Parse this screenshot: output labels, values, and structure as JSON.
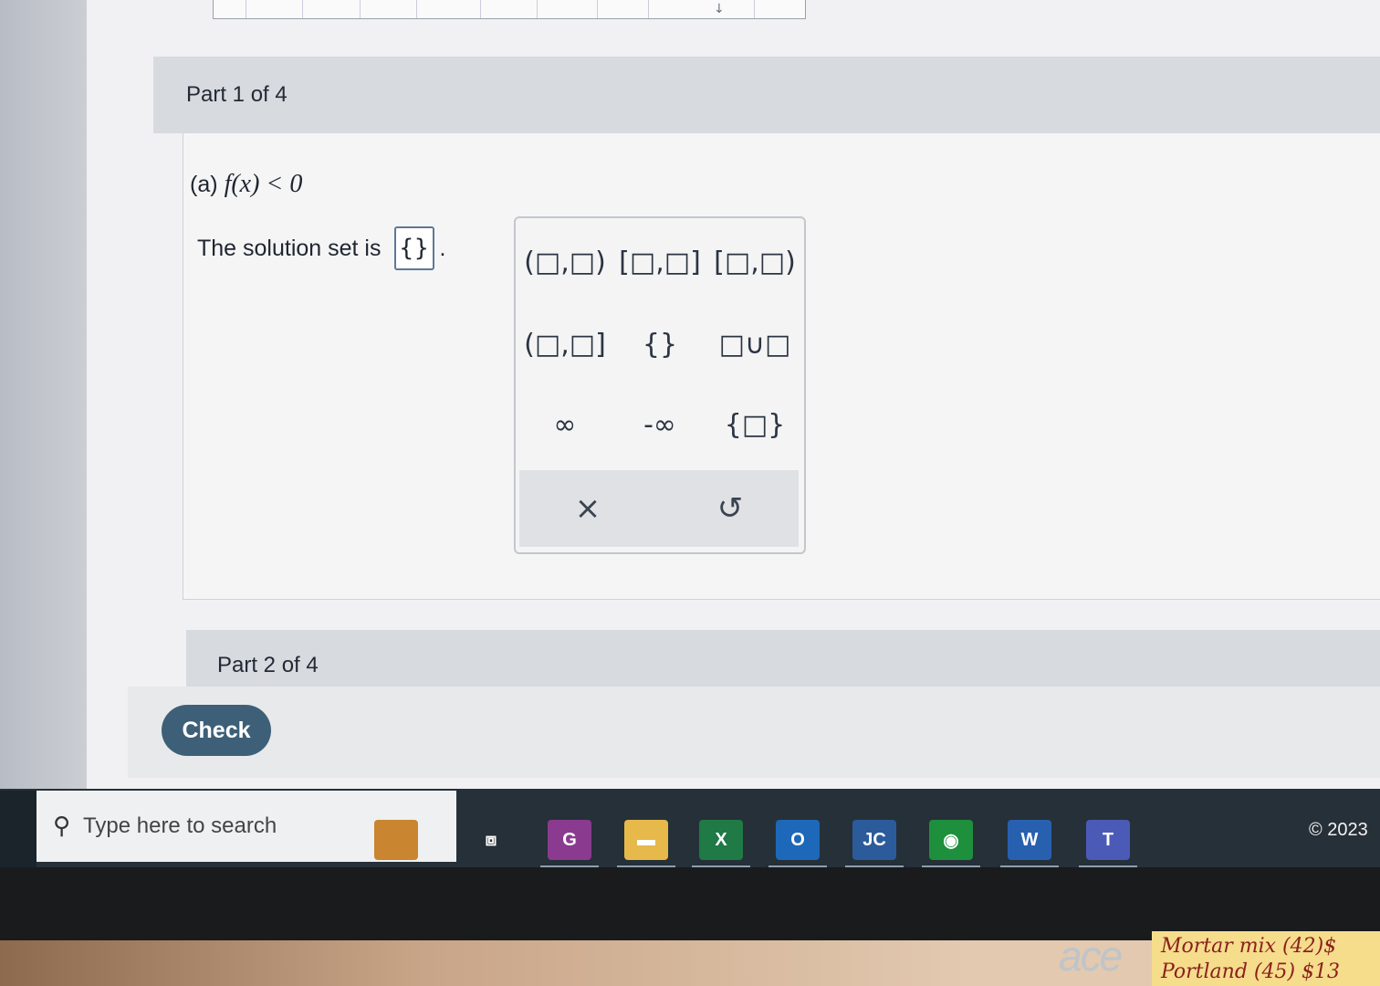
{
  "part1": {
    "header": "Part 1 of 4"
  },
  "question": {
    "prefix": "(a)",
    "expression": "f(x) < 0"
  },
  "solution": {
    "label": "The solution set is",
    "value": "{}",
    "suffix": "."
  },
  "palette": {
    "buttons": [
      "(□,□)",
      "[□,□]",
      "[□,□)",
      "(□,□]",
      "{}",
      "□∪□",
      "∞",
      "-∞",
      "{□}"
    ],
    "clear": "×",
    "undo": "↺"
  },
  "part2": {
    "header": "Part 2 of 4"
  },
  "check_button": "Check",
  "taskbar": {
    "search_placeholder": "Type here to search",
    "search_icon": "⚲",
    "apps": [
      {
        "name": "briefcase",
        "label": "",
        "color": "#c9852f"
      },
      {
        "name": "task-view",
        "label": "⧈",
        "color": "#263038"
      },
      {
        "name": "pdf",
        "label": "G",
        "color": "#8a3b8f"
      },
      {
        "name": "file-explorer",
        "label": "▬",
        "color": "#e6b94a"
      },
      {
        "name": "excel",
        "label": "X",
        "color": "#1f7a45"
      },
      {
        "name": "outlook",
        "label": "O",
        "color": "#1d68b8"
      },
      {
        "name": "jc",
        "label": "JC",
        "color": "#2c5b9c"
      },
      {
        "name": "chrome",
        "label": "◉",
        "color": "#1e8f3c"
      },
      {
        "name": "word",
        "label": "W",
        "color": "#2860b0"
      },
      {
        "name": "teams",
        "label": "T",
        "color": "#4c5ab7"
      }
    ],
    "copyright": "© 2023"
  },
  "monitor": {
    "brand": "ace"
  },
  "sticky_note": {
    "line1": "Mortar mix (42)$",
    "line2": "Portland (45) $13"
  }
}
